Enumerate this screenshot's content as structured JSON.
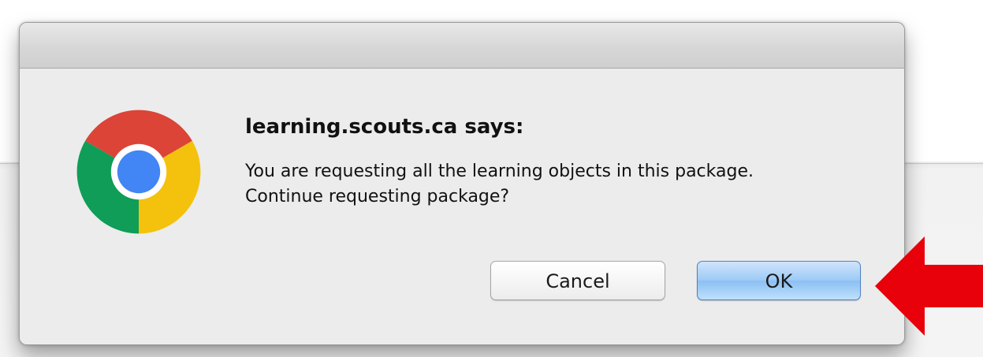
{
  "dialog": {
    "title": "learning.scouts.ca says:",
    "message": "You are requesting all the learning objects in this package. Continue requesting package?",
    "app_icon": "chrome-logo-icon"
  },
  "buttons": {
    "cancel_label": "Cancel",
    "ok_label": "OK"
  },
  "annotation": {
    "arrow_icon": "red-arrow-icon",
    "arrow_color": "#e8000a"
  },
  "colors": {
    "chrome_red": "#db4437",
    "chrome_yellow": "#f4c20d",
    "chrome_green": "#0f9d58",
    "chrome_blue": "#4285f4",
    "ok_button": "#9fcbf6"
  }
}
